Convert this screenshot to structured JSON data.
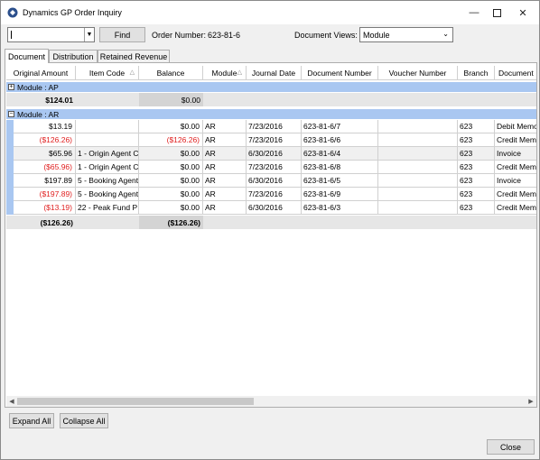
{
  "window": {
    "title": "Dynamics GP Order Inquiry"
  },
  "toolbar": {
    "search_value": "",
    "find_label": "Find",
    "order_number_label": "Order Number:",
    "order_number_value": "623-81-6",
    "document_views_label": "Document Views:",
    "document_views_value": "Module"
  },
  "tabs": [
    "Document",
    "Distribution",
    "Retained Revenue"
  ],
  "columns": [
    "Original Amount",
    "Item Code",
    "Balance",
    "Module",
    "Journal Date",
    "Document Number",
    "Voucher Number",
    "Branch",
    "Document"
  ],
  "groups": {
    "ap": {
      "label": "Module : AP",
      "expander": "+",
      "total_original": "$124.01",
      "total_balance": "$0.00"
    },
    "ar": {
      "label": "Module : AR",
      "expander": "−",
      "total_original": "($126.26)",
      "total_balance": "($126.26)"
    }
  },
  "rows": [
    {
      "original": "$13.19",
      "item": "",
      "balance": "$0.00",
      "module": "AR",
      "date": "7/23/2016",
      "doc": "623-81-6/7",
      "voucher": "",
      "branch": "623",
      "type": "Debit Memo",
      "orig_red": false,
      "bal_red": false
    },
    {
      "original": "($126.26)",
      "item": "",
      "balance": "($126.26)",
      "module": "AR",
      "date": "7/23/2016",
      "doc": "623-81-6/6",
      "voucher": "",
      "branch": "623",
      "type": "Credit Memo",
      "orig_red": true,
      "bal_red": true
    },
    {
      "original": "$65.96",
      "item": "1 - Origin Agent C",
      "balance": "$0.00",
      "module": "AR",
      "date": "6/30/2016",
      "doc": "623-81-6/4",
      "voucher": "",
      "branch": "623",
      "type": "Invoice",
      "orig_red": false,
      "bal_red": false
    },
    {
      "original": "($65.96)",
      "item": "1 - Origin Agent C",
      "balance": "$0.00",
      "module": "AR",
      "date": "7/23/2016",
      "doc": "623-81-6/8",
      "voucher": "",
      "branch": "623",
      "type": "Credit Memo",
      "orig_red": true,
      "bal_red": false
    },
    {
      "original": "$197.89",
      "item": "5 - Booking Agent",
      "balance": "$0.00",
      "module": "AR",
      "date": "6/30/2016",
      "doc": "623-81-6/5",
      "voucher": "",
      "branch": "623",
      "type": "Invoice",
      "orig_red": false,
      "bal_red": false
    },
    {
      "original": "($197.89)",
      "item": "5 - Booking Agent",
      "balance": "$0.00",
      "module": "AR",
      "date": "7/23/2016",
      "doc": "623-81-6/9",
      "voucher": "",
      "branch": "623",
      "type": "Credit Memo",
      "orig_red": true,
      "bal_red": false
    },
    {
      "original": "($13.19)",
      "item": "22 - Peak Fund P",
      "balance": "$0.00",
      "module": "AR",
      "date": "6/30/2016",
      "doc": "623-81-6/3",
      "voucher": "",
      "branch": "623",
      "type": "Credit Memo",
      "orig_red": true,
      "bal_red": false
    }
  ],
  "footer": {
    "expand_all": "Expand All",
    "collapse_all": "Collapse All",
    "close": "Close"
  },
  "colors": {
    "group_header": "#a9c7f1",
    "negative": "#e02020"
  }
}
